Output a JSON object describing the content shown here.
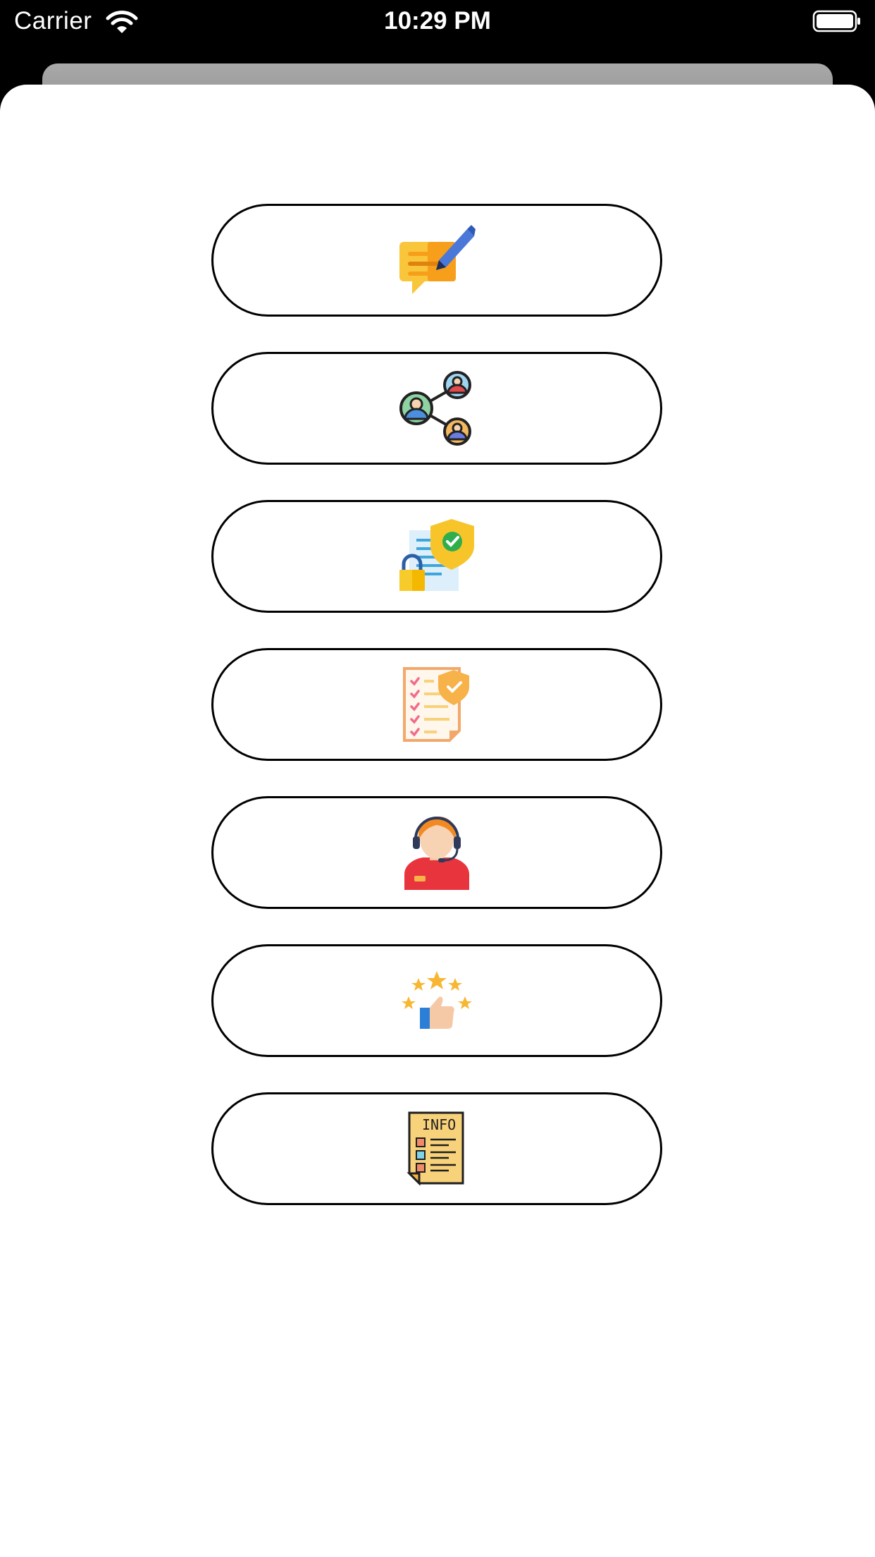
{
  "status_bar": {
    "carrier": "Carrier",
    "time": "10:29 PM",
    "wifi_icon": "wifi-icon",
    "battery_icon": "battery-icon"
  },
  "menu": {
    "items": [
      {
        "icon": "feedback-note-icon"
      },
      {
        "icon": "share-network-icon"
      },
      {
        "icon": "privacy-document-icon"
      },
      {
        "icon": "terms-checklist-icon"
      },
      {
        "icon": "customer-support-icon"
      },
      {
        "icon": "rate-us-icon"
      },
      {
        "icon": "info-document-icon"
      }
    ]
  }
}
